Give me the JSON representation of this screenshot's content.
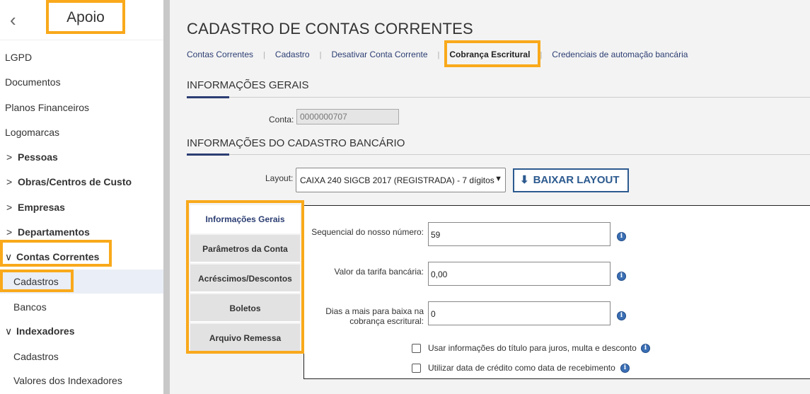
{
  "sidebar": {
    "title": "Apoio",
    "back_icon": "chevron-left-icon",
    "items": [
      {
        "label": "LGPD"
      },
      {
        "label": "Documentos"
      },
      {
        "label": "Planos Financeiros"
      },
      {
        "label": "Logomarcas"
      },
      {
        "label": "Pessoas",
        "chevron": ">"
      },
      {
        "label": "Obras/Centros de Custo",
        "chevron": ">"
      },
      {
        "label": "Empresas",
        "chevron": ">"
      },
      {
        "label": "Departamentos",
        "chevron": ">"
      },
      {
        "label": "Contas Correntes",
        "chevron": "∨"
      },
      {
        "label": "Cadastros"
      },
      {
        "label": "Bancos"
      },
      {
        "label": "Indexadores",
        "chevron": "∨"
      },
      {
        "label": "Cadastros"
      },
      {
        "label": "Valores dos Indexadores"
      }
    ]
  },
  "main": {
    "title": "CADASTRO DE CONTAS CORRENTES",
    "subnav": [
      "Contas Correntes",
      "Cadastro",
      "Desativar Conta Corrente",
      "Cobrança Escritural",
      "Credenciais de automação bancária"
    ],
    "section_general": "INFORMAÇÕES GERAIS",
    "conta_label": "Conta:",
    "conta_value": "0000000707",
    "section_bank": "INFORMAÇÕES DO CADASTRO BANCÁRIO",
    "layout_label": "Layout:",
    "layout_value": "CAIXA 240 SIGCB 2017 (REGISTRADA) - 7 dígitos",
    "download_button": "BAIXAR LAYOUT",
    "tabs": [
      "Informações Gerais",
      "Parâmetros da Conta",
      "Acréscimos/Descontos",
      "Boletos",
      "Arquivo Remessa"
    ],
    "fields": [
      {
        "label": "Sequencial do nosso número:",
        "value": "59"
      },
      {
        "label": "Valor da tarifa bancária:",
        "value": "0,00"
      },
      {
        "label": "Dias a mais para baixa na cobrança escritural:",
        "value": "0"
      }
    ],
    "checkboxes": [
      {
        "label": "Usar informações do título para juros, multa e desconto",
        "checked": false
      },
      {
        "label": "Utilizar data de crédito como data de recebimento",
        "checked": false
      }
    ]
  },
  "colors": {
    "highlight": "#f9a91b",
    "accent": "#2c3e73",
    "button": "#2c5a8f",
    "info_icon": "#3b6fb4"
  }
}
